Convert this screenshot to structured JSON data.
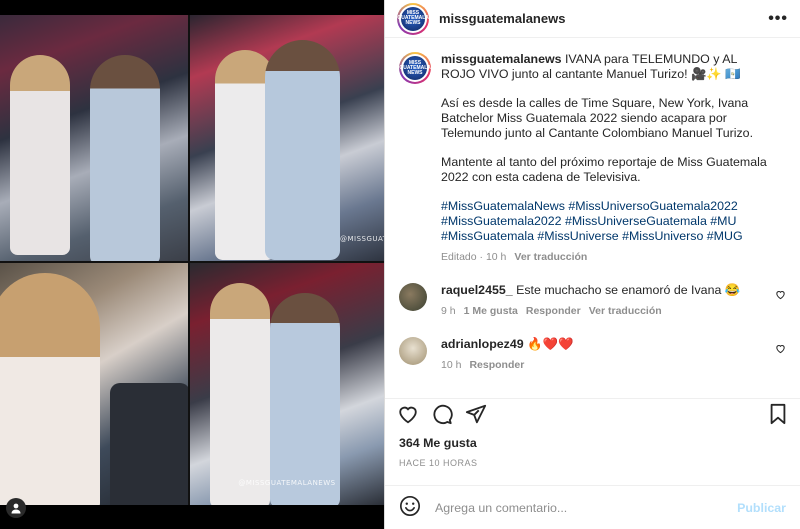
{
  "media": {
    "watermark": "@MISSGUATEMALANEWS"
  },
  "header": {
    "username": "missguatemalanews",
    "avatar_text": "MISS GUATEMALA NEWS"
  },
  "caption": {
    "username": "missguatemalanews",
    "line1": "IVANA para TELEMUNDO y AL ROJO VIVO junto al cantante Manuel Turizo! 🎥✨ 🇬🇹",
    "para2": "Así es desde la calles de Time Square, New York, Ivana Batchelor Miss Guatemala 2022 siendo acapara por Telemundo junto al Cantante Colombiano Manuel Turizo.",
    "para3": "Mantente al tanto del próximo reportaje de Miss Guatemala 2022 con esta cadena de Televisiva.",
    "hashtags": "#MissGuatemalaNews #MissUniversoGuatemala2022 #MissGuatemala2022 #MissUniverseGuatemala #MU #MissGuatemala #MissUniverse #MissUniverso #MUG",
    "edited": "Editado · 10 h",
    "see_translation": "Ver traducción"
  },
  "comments": [
    {
      "username": "raquel2455_",
      "text": "Este muchacho se enamoró de Ivana 😂",
      "time": "9 h",
      "likes": "1 Me gusta",
      "reply": "Responder",
      "translate": "Ver traducción"
    },
    {
      "username": "adrianlopez49",
      "text": "🔥❤️❤️",
      "time": "10 h",
      "reply": "Responder"
    }
  ],
  "stats": {
    "likes": "364 Me gusta",
    "time_ago": "HACE 10 HORAS"
  },
  "add_comment": {
    "placeholder": "Agrega un comentario...",
    "publish": "Publicar"
  },
  "icons": {
    "more": "more-icon",
    "like": "heart-icon",
    "comment": "comment-icon",
    "share": "share-icon",
    "save": "bookmark-icon",
    "emoji": "emoji-icon",
    "tag": "user-tag-icon"
  },
  "colors": {
    "link": "#00376b",
    "muted": "#8e8e8e",
    "publish": "#b2dffc"
  }
}
